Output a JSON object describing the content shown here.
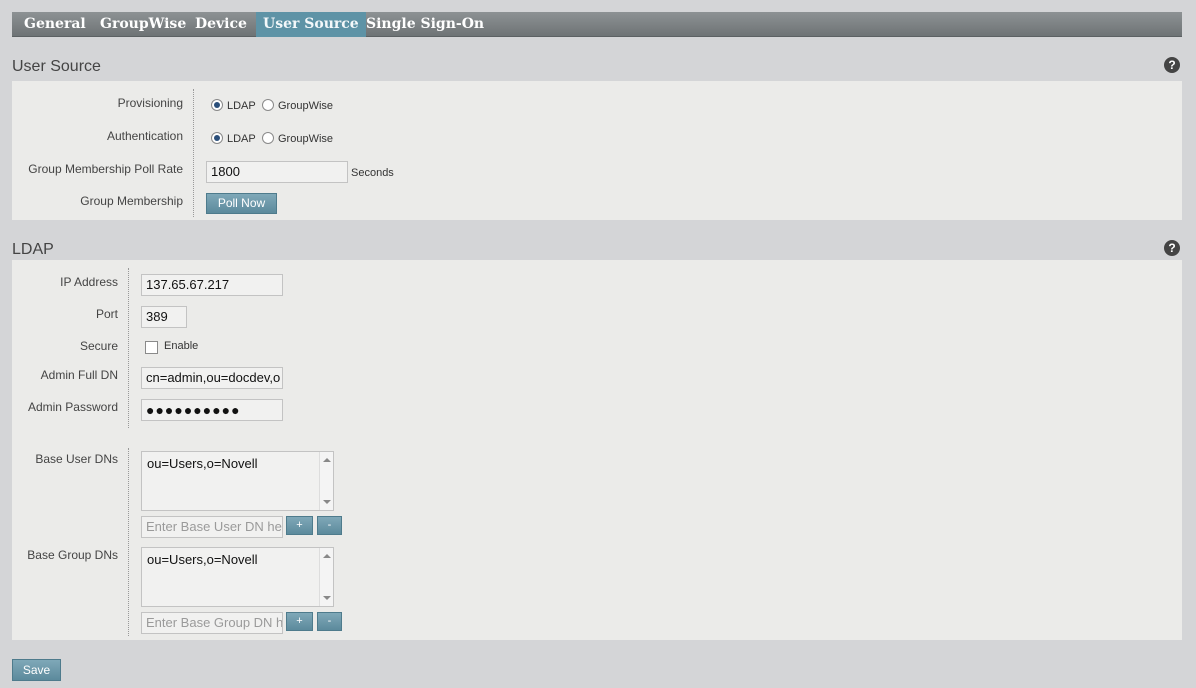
{
  "tabs": [
    {
      "label": "General"
    },
    {
      "label": "GroupWise"
    },
    {
      "label": "Device"
    },
    {
      "label": "User Source",
      "active": true
    },
    {
      "label": "Single Sign-On"
    }
  ],
  "user_source": {
    "title": "User Source",
    "help_icon": "?",
    "provisioning": {
      "label": "Provisioning",
      "options": [
        "LDAP",
        "GroupWise"
      ],
      "selected": "LDAP"
    },
    "authentication": {
      "label": "Authentication",
      "options": [
        "LDAP",
        "GroupWise"
      ],
      "selected": "LDAP"
    },
    "poll_rate": {
      "label": "Group Membership Poll Rate",
      "value": "1800",
      "unit": "Seconds"
    },
    "group_membership": {
      "label": "Group Membership",
      "button": "Poll Now"
    }
  },
  "ldap": {
    "title": "LDAP",
    "help_icon": "?",
    "ip_address": {
      "label": "IP Address",
      "value": "137.65.67.217"
    },
    "port": {
      "label": "Port",
      "value": "389"
    },
    "secure": {
      "label": "Secure",
      "checkbox_label": "Enable",
      "checked": false
    },
    "admin_dn": {
      "label": "Admin Full DN",
      "value": "cn=admin,ou=docdev,o"
    },
    "admin_password": {
      "label": "Admin Password",
      "value": "●●●●●●●●●●"
    },
    "base_user_dns": {
      "label": "Base User DNs",
      "items": [
        "ou=Users,o=Novell"
      ],
      "placeholder": "Enter Base User DN here",
      "add": "+",
      "remove": "-"
    },
    "base_group_dns": {
      "label": "Base Group DNs",
      "items": [
        "ou=Users,o=Novell"
      ],
      "placeholder": "Enter Base Group DN here",
      "add": "+",
      "remove": "-"
    }
  },
  "footer": {
    "save_label": "Save"
  }
}
